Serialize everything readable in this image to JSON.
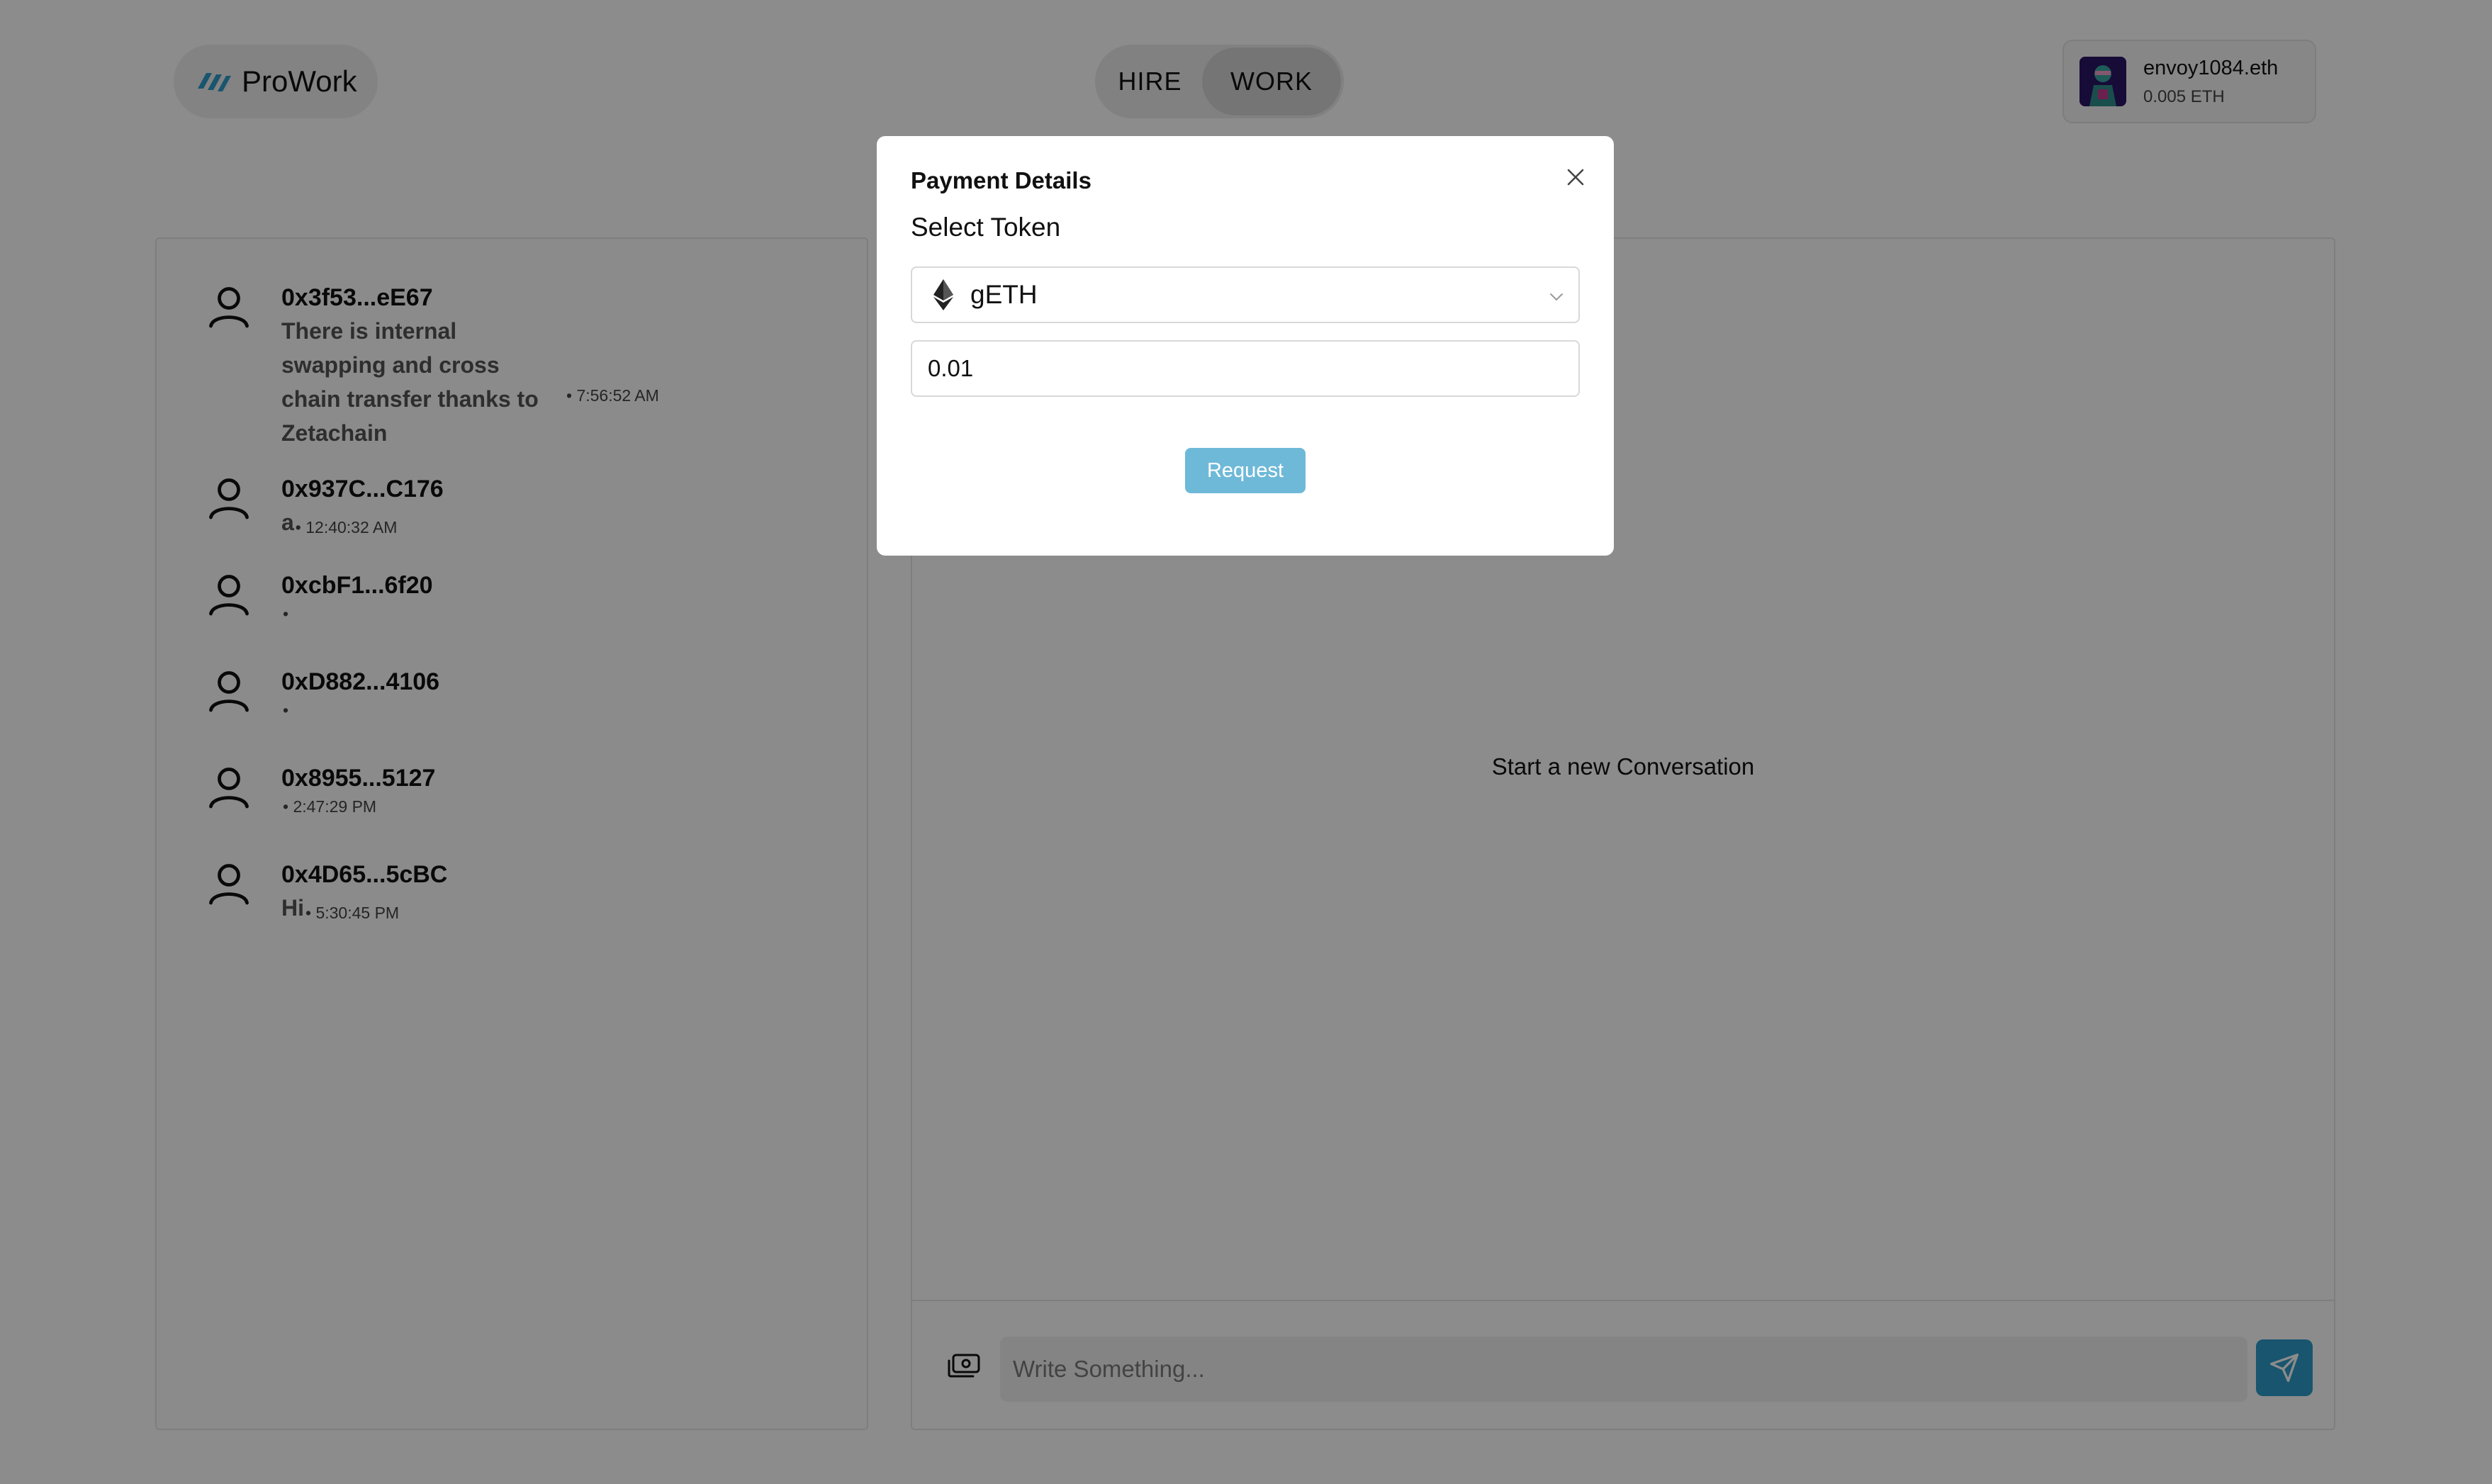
{
  "brand": {
    "name": "ProWork",
    "accent": "#2e9bc9"
  },
  "nav": {
    "hire_label": "HIRE",
    "work_label": "WORK",
    "active": "WORK"
  },
  "account": {
    "name": "envoy1084.eth",
    "balance": "0.005 ETH"
  },
  "conversations": [
    {
      "address": "0x3f53...eE67",
      "message": "There is internal swapping and cross chain transfer thanks to Zetachain",
      "time": "• 7:56:52 AM"
    },
    {
      "address": "0x937C...C176",
      "message": "a",
      "time": "• 12:40:32 AM"
    },
    {
      "address": "0xcbF1...6f20",
      "message": "",
      "time": "•"
    },
    {
      "address": "0xD882...4106",
      "message": "",
      "time": "•"
    },
    {
      "address": "0x8955...5127",
      "message": "",
      "time": "• 2:47:29 PM"
    },
    {
      "address": "0x4D65...5cBC",
      "message": "Hi",
      "time": "• 5:30:45 PM"
    }
  ],
  "chat": {
    "empty_text": "Start a new Conversation",
    "input_placeholder": "Write Something..."
  },
  "modal": {
    "title": "Payment Details",
    "select_label": "Select Token",
    "selected_token": "gETH",
    "amount": "0.01",
    "request_label": "Request"
  },
  "icons": [
    "prowork-logo-icon",
    "user-icon",
    "money-icon",
    "send-icon",
    "close-icon",
    "ethereum-icon",
    "chevron-down-icon"
  ]
}
